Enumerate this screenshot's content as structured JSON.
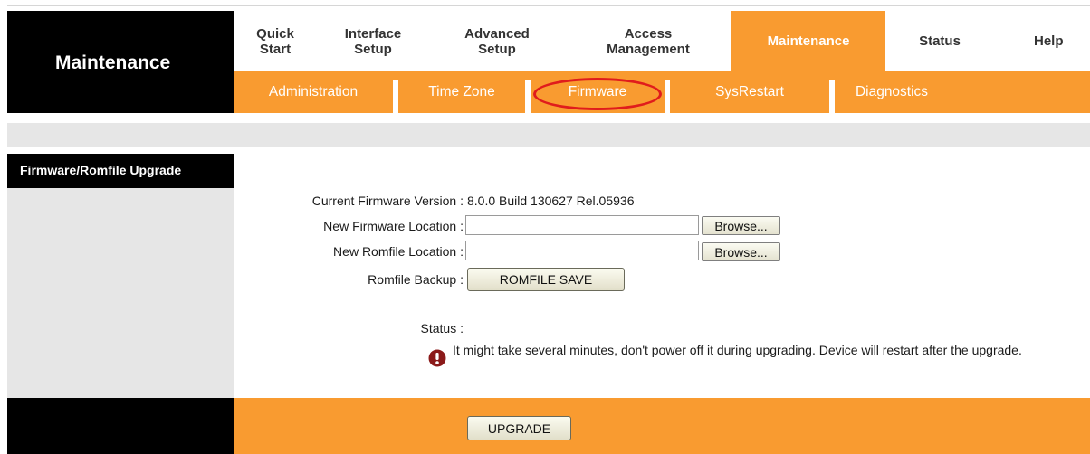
{
  "brand": {
    "title": "Maintenance"
  },
  "nav": [
    {
      "id": "quick-start",
      "label": "Quick\nStart",
      "active": false
    },
    {
      "id": "interface-setup",
      "label": "Interface\nSetup",
      "active": false
    },
    {
      "id": "advanced-setup",
      "label": "Advanced\nSetup",
      "active": false
    },
    {
      "id": "access-management",
      "label": "Access\nManagement",
      "active": false
    },
    {
      "id": "maintenance",
      "label": "Maintenance",
      "active": true
    },
    {
      "id": "status",
      "label": "Status",
      "active": false
    },
    {
      "id": "help",
      "label": "Help",
      "active": false
    }
  ],
  "subnav": [
    {
      "id": "administration",
      "label": "Administration"
    },
    {
      "id": "time-zone",
      "label": "Time Zone"
    },
    {
      "id": "firmware",
      "label": "Firmware",
      "selected": true
    },
    {
      "id": "sysrestart",
      "label": "SysRestart"
    },
    {
      "id": "diagnostics",
      "label": "Diagnostics"
    }
  ],
  "section": {
    "title": "Firmware/Romfile Upgrade"
  },
  "form": {
    "current_version_label": "Current Firmware Version :",
    "current_version_value": "8.0.0 Build 130627 Rel.05936",
    "firmware_location_label": "New Firmware Location :",
    "firmware_location_value": "",
    "romfile_location_label": "New Romfile Location :",
    "romfile_location_value": "",
    "browse_label": "Browse...",
    "romfile_backup_label": "Romfile Backup :",
    "romfile_save_label": "ROMFILE SAVE",
    "status_label": "Status :",
    "status_message": "It might take several minutes, don't power off it during upgrading. Device will restart after the upgrade."
  },
  "footer": {
    "upgrade_label": "UPGRADE"
  },
  "colors": {
    "accent": "#f99b30",
    "dark": "#000000",
    "panel_gray": "#e6e6e6",
    "highlight_ring": "#e01c1c",
    "warning_icon": "#8b1a1a"
  },
  "icons": {
    "warning": "exclamation-circle-icon"
  }
}
